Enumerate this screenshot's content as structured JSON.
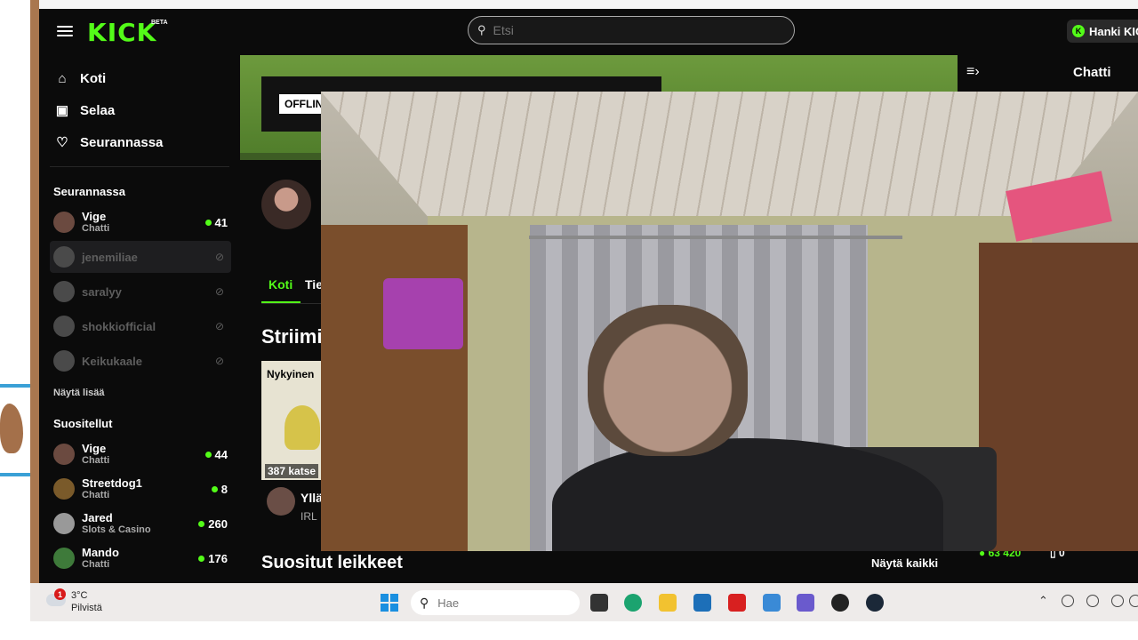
{
  "header": {
    "logo_text": "KICK",
    "logo_badge": "BETA",
    "search_placeholder": "Etsi",
    "get_kick_label": "Hanki KIC"
  },
  "sidebar": {
    "nav": [
      {
        "label": "Koti",
        "icon": "home-icon"
      },
      {
        "label": "Selaa",
        "icon": "browse-icon"
      },
      {
        "label": "Seurannassa",
        "icon": "heart-icon"
      }
    ],
    "following_title": "Seurannassa",
    "following": [
      {
        "name": "Vige",
        "category": "Chatti",
        "viewers": "41",
        "live": true
      },
      {
        "name": "jenemiliae",
        "category": "",
        "viewers": "",
        "live": false
      },
      {
        "name": "saralyy",
        "category": "",
        "viewers": "",
        "live": false
      },
      {
        "name": "shokkiofficial",
        "category": "",
        "viewers": "",
        "live": false
      },
      {
        "name": "Keikukaale",
        "category": "",
        "viewers": "",
        "live": false
      }
    ],
    "show_more": "Näytä lisää",
    "recommended_title": "Suositellut",
    "recommended": [
      {
        "name": "Vige",
        "category": "Chatti",
        "viewers": "44"
      },
      {
        "name": "Streetdog1",
        "category": "Chatti",
        "viewers": "8"
      },
      {
        "name": "Jared",
        "category": "Slots & Casino",
        "viewers": "260"
      },
      {
        "name": "Mando",
        "category": "Chatti",
        "viewers": "176"
      }
    ]
  },
  "main": {
    "offline_badge": "OFFLIN",
    "tabs": [
      {
        "label": "Koti"
      },
      {
        "label": "Tie"
      }
    ],
    "streams_title": "Striimi",
    "card": {
      "current_label": "Nykyinen",
      "viewers_label": "387 katse",
      "title": "Yllä",
      "category": "IRL"
    },
    "clips_title": "Suositut leikkeet",
    "see_all": "Näytä kaikki"
  },
  "chat": {
    "title": "Chatti",
    "followers": "63 420",
    "count": "0"
  },
  "taskbar": {
    "badge": "1",
    "temperature": "3°C",
    "weather": "Pilvistä",
    "search_placeholder": "Hae"
  },
  "colors": {
    "accent": "#53fc18",
    "background": "#0b0b0b",
    "taskbar": "#eeebea"
  }
}
